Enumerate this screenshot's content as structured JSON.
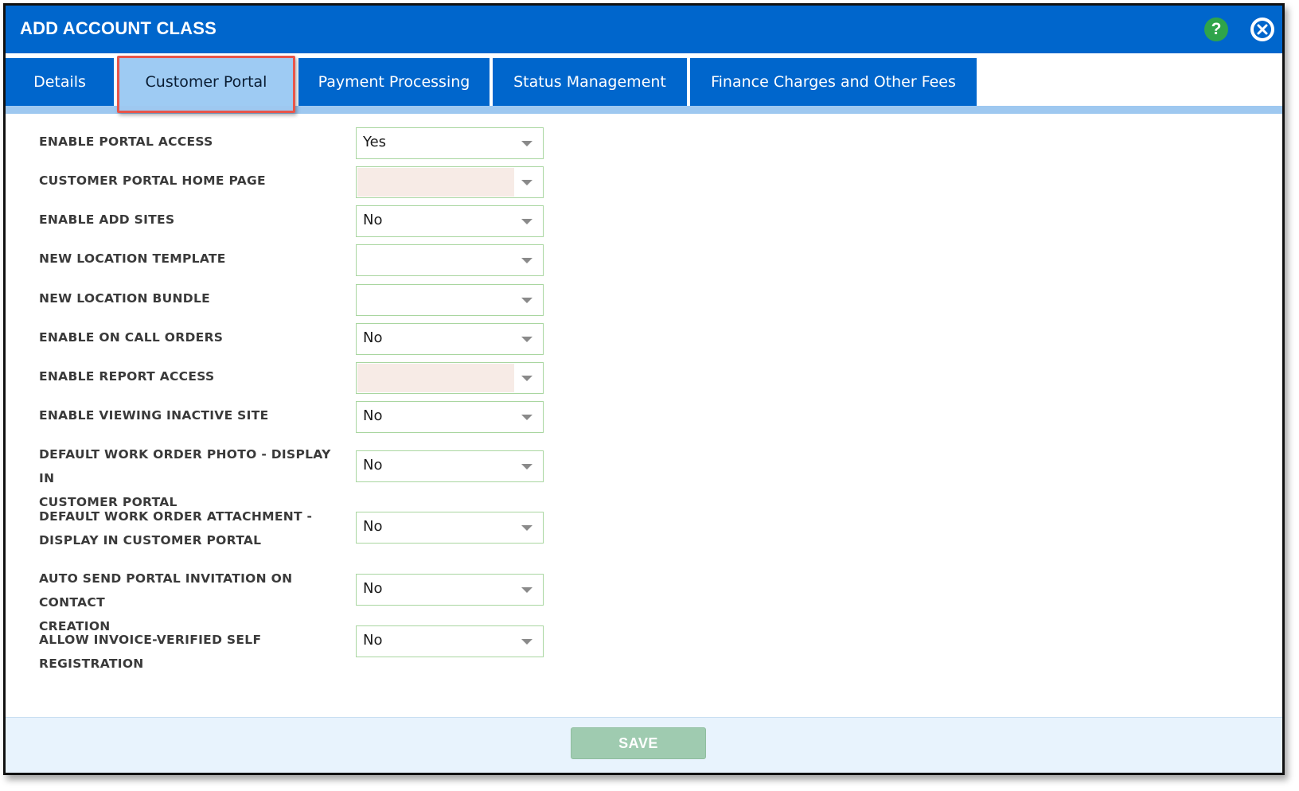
{
  "dialog": {
    "title": "ADD ACCOUNT CLASS",
    "help_label": "?",
    "accent_color": "#0066cc"
  },
  "tabs": [
    {
      "label": "Details",
      "active": false
    },
    {
      "label": "Customer Portal",
      "active": true
    },
    {
      "label": "Payment Processing",
      "active": false
    },
    {
      "label": "Status Management",
      "active": false
    },
    {
      "label": "Finance Charges and Other Fees",
      "active": false
    }
  ],
  "form": {
    "fields": [
      {
        "label": "ENABLE PORTAL ACCESS",
        "value": "Yes"
      },
      {
        "label": "CUSTOMER PORTAL HOME PAGE",
        "value": ""
      },
      {
        "label": "ENABLE ADD SITES",
        "value": "No"
      },
      {
        "label": "NEW LOCATION TEMPLATE",
        "value": ""
      },
      {
        "label": "NEW LOCATION BUNDLE",
        "value": ""
      },
      {
        "label": "ENABLE ON CALL ORDERS",
        "value": "No"
      },
      {
        "label": "ENABLE REPORT ACCESS",
        "value": ""
      },
      {
        "label": "ENABLE VIEWING INACTIVE SITE",
        "value": "No"
      },
      {
        "label": "DEFAULT WORK ORDER PHOTO - DISPLAY IN",
        "label2": "CUSTOMER PORTAL",
        "value": "No"
      },
      {
        "label": "DEFAULT WORK ORDER ATTACHMENT -",
        "label2": "DISPLAY IN CUSTOMER PORTAL",
        "value": "No"
      },
      {
        "label": "AUTO SEND PORTAL INVITATION ON CONTACT",
        "label2": "CREATION",
        "value": "No"
      },
      {
        "label": "ALLOW INVOICE-VERIFIED SELF REGISTRATION",
        "value": "No"
      }
    ]
  },
  "footer": {
    "save_label": "SAVE"
  }
}
